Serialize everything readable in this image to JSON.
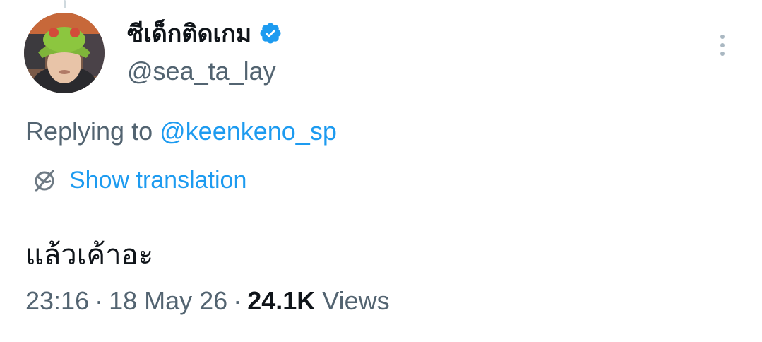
{
  "tweet": {
    "author": {
      "display_name": "ซีเด็กติดเกม",
      "handle": "@sea_ta_lay",
      "verified": true
    },
    "replying_prefix": "Replying to",
    "replying_to": "@keenkeno_sp",
    "translate_label": "Show translation",
    "text": "แล้วเค้าอะ",
    "time": "23:16",
    "date": "18 May 26",
    "separator": "·",
    "views_count": "24.1K",
    "views_label": "Views"
  },
  "icons": {
    "verified": "verified-badge-icon",
    "more": "more-options-icon",
    "translate": "globe-icon"
  },
  "colors": {
    "accent": "#1d9bf0",
    "secondary_text": "#536471",
    "primary_text": "#0f1419"
  }
}
